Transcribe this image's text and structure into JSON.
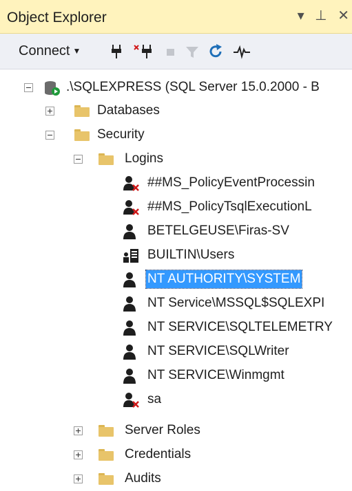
{
  "panel": {
    "title": "Object Explorer",
    "controls": {
      "dropdown": "▾",
      "pin": "⊥",
      "close": "✕"
    }
  },
  "toolbar": {
    "connect_label": "Connect",
    "icons": [
      "connect-plug-icon",
      "disconnect-icon",
      "stop-icon",
      "filter-icon",
      "refresh-icon",
      "activity-monitor-icon"
    ]
  },
  "tree": {
    "server": ".\\SQLEXPRESS (SQL Server 15.0.2000 - B",
    "databases": "Databases",
    "security": "Security",
    "logins": "Logins",
    "login_items": [
      "##MS_PolicyEventProcessin",
      "##MS_PolicyTsqlExecutionL",
      "BETELGEUSE\\Firas-SV",
      "BUILTIN\\Users",
      "NT AUTHORITY\\SYSTEM",
      "NT Service\\MSSQL$SQLEXPI",
      "NT SERVICE\\SQLTELEMETRY",
      "NT SERVICE\\SQLWriter",
      "NT SERVICE\\Winmgmt",
      "sa"
    ],
    "server_roles": "Server Roles",
    "credentials": "Credentials",
    "audits": "Audits"
  },
  "colors": {
    "title_bg": "#fff3bd",
    "selection": "#3399ff",
    "folder": "#e8c46a"
  }
}
